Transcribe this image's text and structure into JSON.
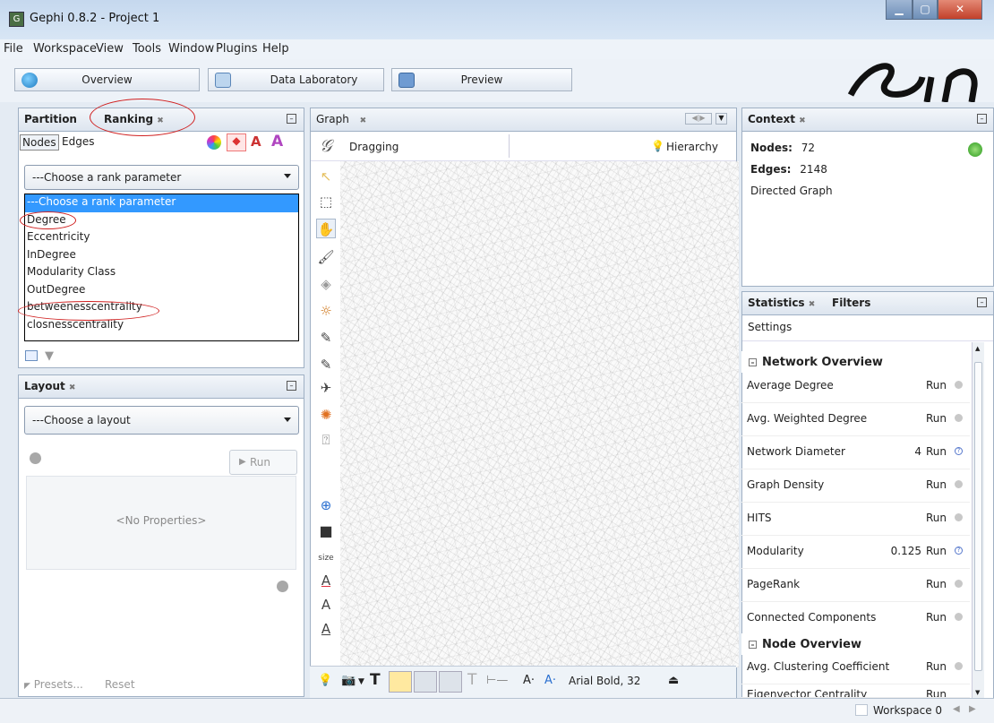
{
  "window": {
    "title": "Gephi 0.8.2 - Project 1",
    "app_icon": "gephi-icon"
  },
  "menu": [
    "File",
    "Workspace",
    "View",
    "Tools",
    "Window",
    "Plugins",
    "Help"
  ],
  "toolbar": {
    "tabs": [
      {
        "label": "Overview",
        "icon": "overview-globe-icon",
        "color": "#2f9ed8"
      },
      {
        "label": "Data Laboratory",
        "icon": "data-lab-icon",
        "color": "#6aa0d0"
      },
      {
        "label": "Preview",
        "icon": "preview-monitor-icon",
        "color": "#5a8cc8"
      }
    ]
  },
  "ranking_panel": {
    "tab_partition": "Partition",
    "tab_ranking": "Ranking",
    "nodes_tab": "Nodes",
    "edges_tab": "Edges",
    "combo_value": "---Choose a rank parameter",
    "options": [
      "---Choose a rank parameter",
      "Degree",
      "Eccentricity",
      "InDegree",
      "Modularity Class",
      "OutDegree",
      "betweenesscentrality",
      "closnesscentrality"
    ],
    "selected_index": 0
  },
  "layout_panel": {
    "title": "Layout",
    "combo_value": "---Choose a layout",
    "run_label": "Run",
    "no_properties": "<No Properties>",
    "presets": "Presets...",
    "reset": "Reset"
  },
  "graph_panel": {
    "tab": "Graph",
    "mode": "Dragging",
    "hierarchy": "Hierarchy",
    "size_label": "size",
    "font_label": "Arial Bold, 32",
    "text_a_minus": "A·",
    "text_a_plus": "A·"
  },
  "context": {
    "title": "Context",
    "nodes_label": "Nodes:",
    "nodes_value": "72",
    "edges_label": "Edges:",
    "edges_value": "2148",
    "graph_type": "Directed Graph"
  },
  "statistics": {
    "tab_statistics": "Statistics",
    "tab_filters": "Filters",
    "settings": "Settings",
    "network_overview": "Network Overview",
    "node_overview": "Node Overview",
    "rows": [
      {
        "name": "Average Degree",
        "value": "",
        "run": "Run",
        "icon": "gray"
      },
      {
        "name": "Avg. Weighted Degree",
        "value": "",
        "run": "Run",
        "icon": "gray"
      },
      {
        "name": "Network Diameter",
        "value": "4",
        "run": "Run",
        "icon": "info"
      },
      {
        "name": "Graph Density",
        "value": "",
        "run": "Run",
        "icon": "gray"
      },
      {
        "name": "HITS",
        "value": "",
        "run": "Run",
        "icon": "gray"
      },
      {
        "name": "Modularity",
        "value": "0.125",
        "run": "Run",
        "icon": "info"
      },
      {
        "name": "PageRank",
        "value": "",
        "run": "Run",
        "icon": "gray"
      },
      {
        "name": "Connected Components",
        "value": "",
        "run": "Run",
        "icon": "gray"
      }
    ],
    "node_rows": [
      {
        "name": "Avg. Clustering Coefficient",
        "run": "Run",
        "icon": "gray"
      },
      {
        "name": "Eigenvector Centrality",
        "run": "Run",
        "icon": "gray"
      }
    ]
  },
  "status": {
    "workspace": "Workspace 0"
  }
}
